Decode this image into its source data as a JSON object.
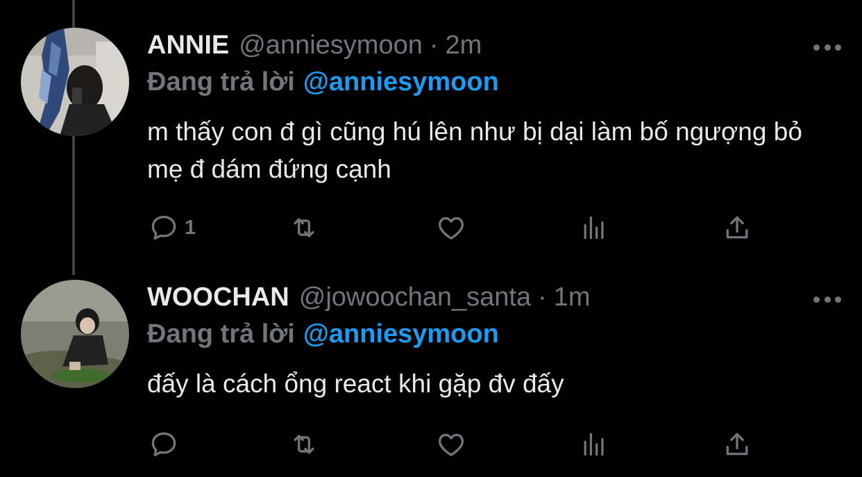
{
  "colors": {
    "background": "#000000",
    "text": "#e7e9ea",
    "muted": "#71767b",
    "accent": "#1d9bf0",
    "thread_line": "#3e4144"
  },
  "tweets": [
    {
      "display_name": "ANNIE",
      "handle": "@anniesymoon",
      "separator": "·",
      "time": "2m",
      "reply_prefix": "Đang trả lời",
      "reply_mention": "@anniesymoon",
      "text": "m thấy con đ gì cũng hú lên như bị dại làm bố ngượng bỏ mẹ đ dám đứng cạnh",
      "reply_count": "1",
      "icons": [
        "reply-icon",
        "retweet-icon",
        "like-icon",
        "views-icon",
        "share-icon",
        "more-icon"
      ]
    },
    {
      "display_name": "WOOCHAN",
      "handle": "@jowoochan_santa",
      "separator": "·",
      "time": "1m",
      "reply_prefix": "Đang trả lời",
      "reply_mention": "@anniesymoon",
      "text": "đấy là cách ổng react khi gặp đv đấy",
      "reply_count": "",
      "icons": [
        "reply-icon",
        "retweet-icon",
        "like-icon",
        "views-icon",
        "share-icon",
        "more-icon"
      ]
    }
  ]
}
